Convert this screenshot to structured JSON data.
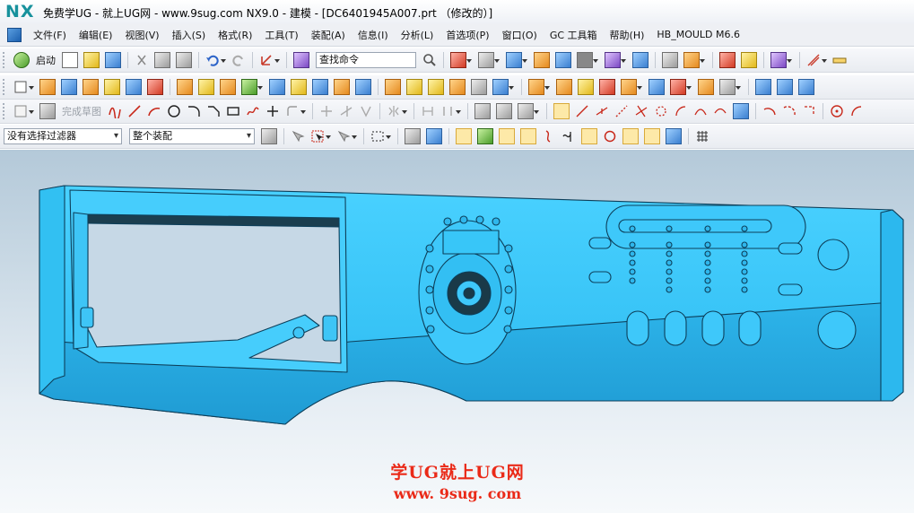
{
  "window": {
    "logo": "NX",
    "title": "免费学UG - 就上UG网 - www.9sug.com NX9.0 - 建模 - [DC6401945A007.prt （修改的）]"
  },
  "menu": {
    "items": [
      "文件(F)",
      "编辑(E)",
      "视图(V)",
      "插入(S)",
      "格式(R)",
      "工具(T)",
      "装配(A)",
      "信息(I)",
      "分析(L)",
      "首选项(P)",
      "窗口(O)",
      "GC 工具箱",
      "帮助(H)",
      "HB_MOULD M6.6"
    ]
  },
  "toolbar": {
    "start_label": "启动",
    "command_search_value": "查找命令",
    "finish_sketch_label": "完成草图",
    "selection_filter_value": "没有选择过滤器",
    "assembly_scope_value": "整个装配"
  },
  "watermark": {
    "line1": "学UG就上UG网",
    "line2": "www. 9sug. com"
  },
  "colors": {
    "model_face": "#35c4f4",
    "model_shadow": "#1fa2d8",
    "watermark": "#ea2a18",
    "logo": "#17919c"
  }
}
